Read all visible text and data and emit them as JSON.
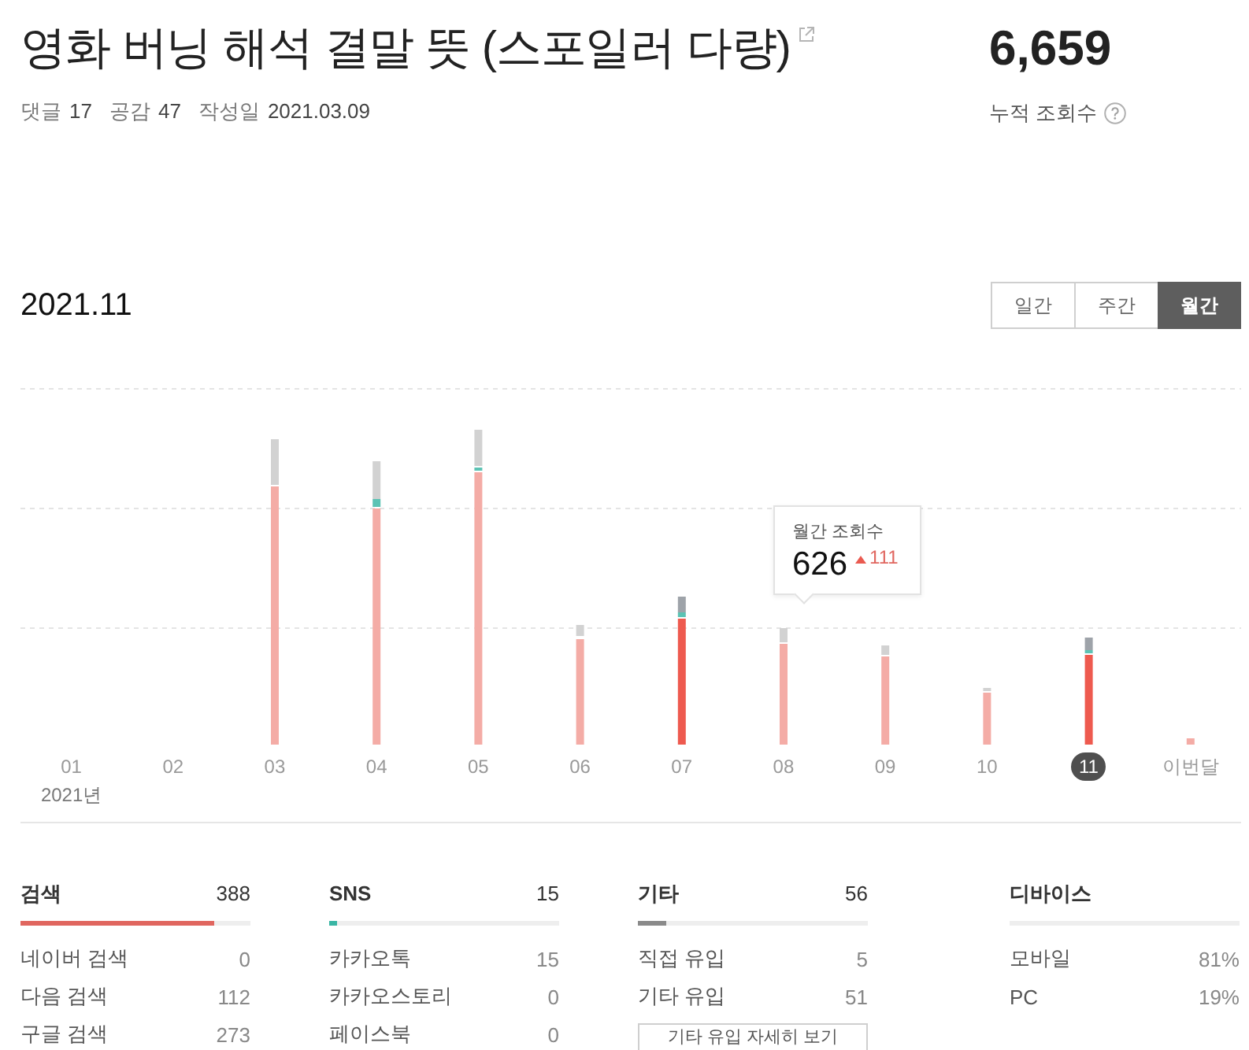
{
  "header": {
    "title": "영화 버닝 해석 결말 뜻 (스포일러 다량)",
    "meta": [
      {
        "label": "댓글",
        "value": "17"
      },
      {
        "label": "공감",
        "value": "47"
      },
      {
        "label": "작성일",
        "value": "2021.03.09"
      }
    ],
    "total": {
      "value": "6,659",
      "label": "누적 조회수"
    }
  },
  "period": {
    "date": "2021.11",
    "tabs": [
      {
        "label": "일간",
        "selected": false
      },
      {
        "label": "주간",
        "selected": false
      },
      {
        "label": "월간",
        "selected": true
      }
    ]
  },
  "chart": {
    "months": [
      {
        "label": "01",
        "selected": false
      },
      {
        "label": "02",
        "selected": false
      },
      {
        "label": "03",
        "selected": false,
        "highlighted": false
      },
      {
        "label": "04",
        "selected": false,
        "highlighted": false
      },
      {
        "label": "05",
        "selected": false,
        "highlighted": false
      },
      {
        "label": "06",
        "selected": false,
        "highlighted": false
      },
      {
        "label": "07",
        "selected": false,
        "highlighted": true
      },
      {
        "label": "08",
        "selected": false,
        "highlighted": false
      },
      {
        "label": "09",
        "selected": false,
        "highlighted": false
      },
      {
        "label": "10",
        "selected": false,
        "highlighted": false
      },
      {
        "label": "11",
        "selected": true,
        "highlighted": true
      },
      {
        "label": "이번달",
        "selected": false,
        "highlighted": false
      }
    ],
    "year_label": "2021년",
    "tooltip": {
      "label": "월간 조회수",
      "value": "626",
      "change": "111"
    }
  },
  "stats": [
    {
      "title": "검색",
      "count": "388",
      "level": 0.845,
      "color": "#e0665f",
      "rows": [
        {
          "label": "네이버 검색",
          "value": "0"
        },
        {
          "label": "다음 검색",
          "value": "112"
        },
        {
          "label": "구글 검색",
          "value": "273"
        }
      ]
    },
    {
      "title": "SNS",
      "count": "15",
      "level": 0.033,
      "color": "#39b5a4",
      "rows": [
        {
          "label": "카카오톡",
          "value": "15"
        },
        {
          "label": "카카오스토리",
          "value": "0"
        },
        {
          "label": "페이스북",
          "value": "0"
        }
      ]
    },
    {
      "title": "기타",
      "count": "56",
      "level": 0.122,
      "color": "#8a8a8a",
      "rows": [
        {
          "label": "직접 유입",
          "value": "5"
        },
        {
          "label": "기타 유입",
          "value": "51"
        }
      ],
      "button": "기타 유입 자세히 보기"
    },
    {
      "title": "디바이스",
      "rows": [
        {
          "label": "모바일",
          "value": "81%"
        },
        {
          "label": "PC",
          "value": "19%"
        }
      ]
    }
  ]
}
